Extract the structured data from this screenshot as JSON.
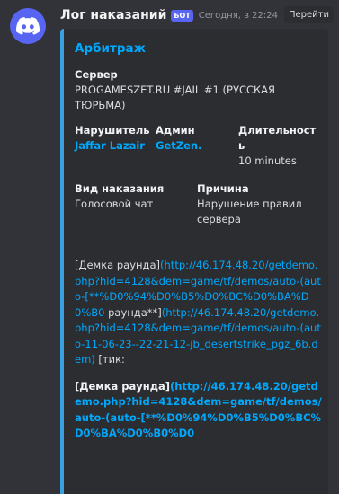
{
  "message": {
    "author": "Лог наказаний",
    "bot_tag": "БОТ",
    "timestamp": "Сегодня, в 22:24",
    "goto_label": "Перейти"
  },
  "embed": {
    "accent_color": "#3ba0e0",
    "title": "Арбитраж",
    "server": {
      "name": "Сервер",
      "value": "PROGAMESZET.RU #JAIL #1 (РУССКАЯ ТЮРЬМА)"
    },
    "violator": {
      "name": "Нарушитель",
      "value": "Jaffar Lazair"
    },
    "admin": {
      "name": "Админ",
      "value": "GetZen."
    },
    "duration": {
      "name": "Длительность",
      "value": "10 minutes"
    },
    "punishment": {
      "name": "Вид наказания",
      "value": "Голосовой чат"
    },
    "reason": {
      "name": "Причина",
      "value": "Нарушение правил сервера"
    },
    "description": {
      "p1_open": "[Демка раунда]",
      "p1_link": "(http://46.174.48.20/getdemo.php?hid=4128&dem=game/tf/demos/auto-(auto-[**%D0%94%D0%B5%D0%BC%D0%BA%D0%B0",
      "p1_text": " раунда**]",
      "p1_link2": "(http://46.174.48.20/getdemo.php?hid=4128&dem=game/tf/demos/auto-(auto-11-06-23--22-21-12-jb_desertstrike_pgz_6b.dem)",
      "p1_tail": " [тик:",
      "p2_open": "[Демка раунда]",
      "p2_link": "(http://46.174.48.20/getdemo.php?hid=4128&dem=game/tf/demos/auto-(auto-[**%D0%94%D0%B5%D0%BC%D0%BA%D0%B0%D0"
    }
  }
}
